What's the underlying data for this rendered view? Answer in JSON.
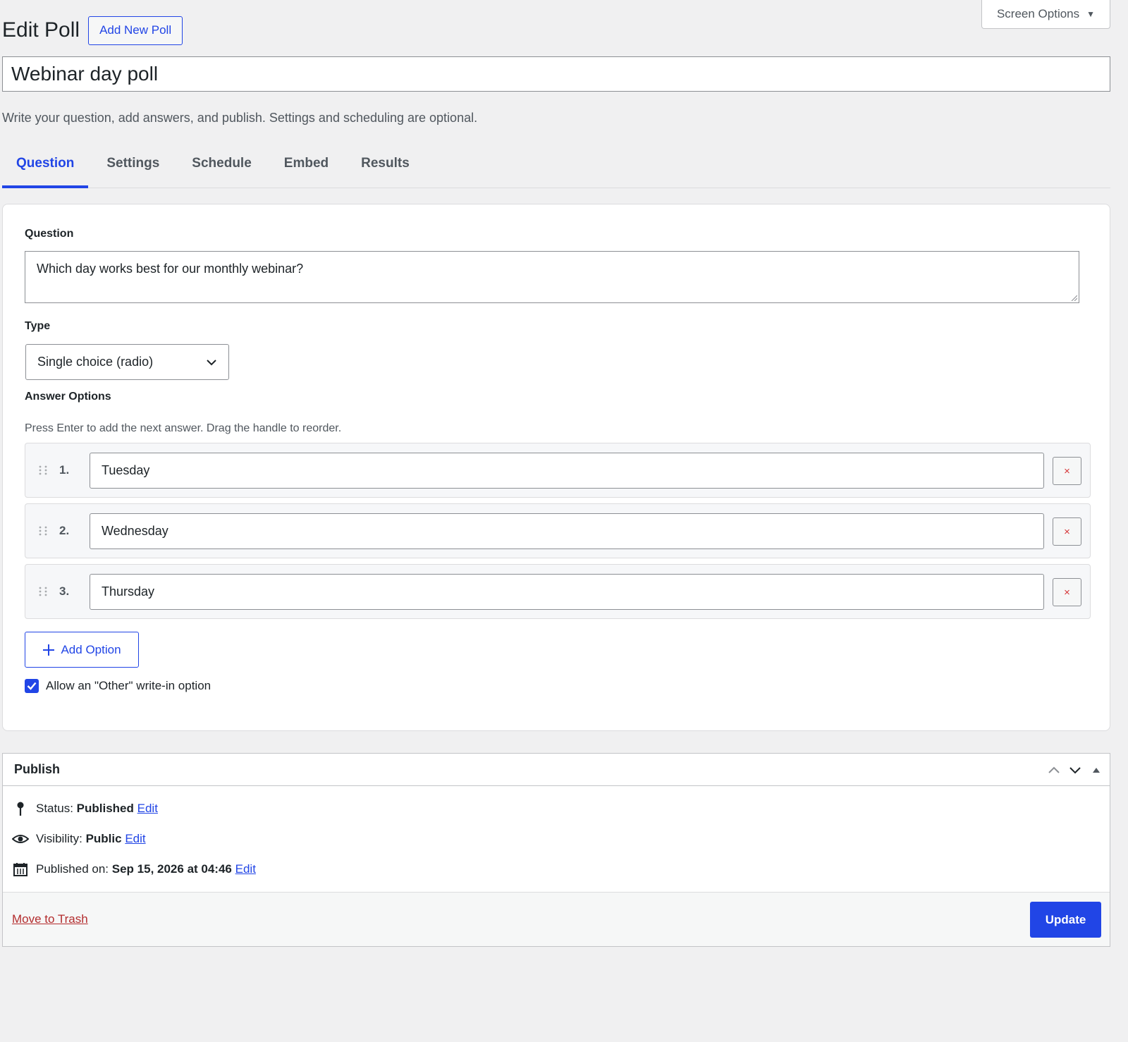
{
  "header": {
    "screen_options": "Screen Options",
    "title": "Edit Poll",
    "add_new": "Add New Poll"
  },
  "poll_title": "Webinar day poll",
  "intro": "Write your question, add answers, and publish. Settings and scheduling are optional.",
  "tabs": [
    {
      "label": "Question",
      "active": true
    },
    {
      "label": "Settings",
      "active": false
    },
    {
      "label": "Schedule",
      "active": false
    },
    {
      "label": "Embed",
      "active": false
    },
    {
      "label": "Results",
      "active": false
    }
  ],
  "question": {
    "label": "Question",
    "value": "Which day works best for our monthly webinar?",
    "type_label": "Type",
    "type_value": "Single choice (radio)",
    "answers_label": "Answer Options",
    "answers_hint": "Press Enter to add the next answer. Drag the handle to reorder.",
    "options": [
      {
        "num": "1.",
        "value": "Tuesday"
      },
      {
        "num": "2.",
        "value": "Wednesday"
      },
      {
        "num": "3.",
        "value": "Thursday"
      }
    ],
    "remove_glyph": "×",
    "add_option": "Add Option",
    "other_label": "Allow an \"Other\" write-in option",
    "other_checked": true
  },
  "publish": {
    "title": "Publish",
    "status_label": "Status:",
    "status_value": "Published",
    "visibility_label": "Visibility:",
    "visibility_value": "Public",
    "published_label": "Published on:",
    "published_value": "Sep 15, 2026 at 04:46",
    "edit_link": "Edit",
    "trash": "Move to Trash",
    "update": "Update"
  },
  "colors": {
    "accent": "#2145e6",
    "danger": "#b32d2e",
    "background": "#f0f0f1"
  },
  "icons": [
    "chevron-down-icon",
    "drag-handle-icon",
    "close-icon",
    "plus-icon",
    "checkmark-icon",
    "pin-icon",
    "eye-icon",
    "calendar-icon",
    "chevron-up-icon",
    "triangle-up-icon"
  ]
}
